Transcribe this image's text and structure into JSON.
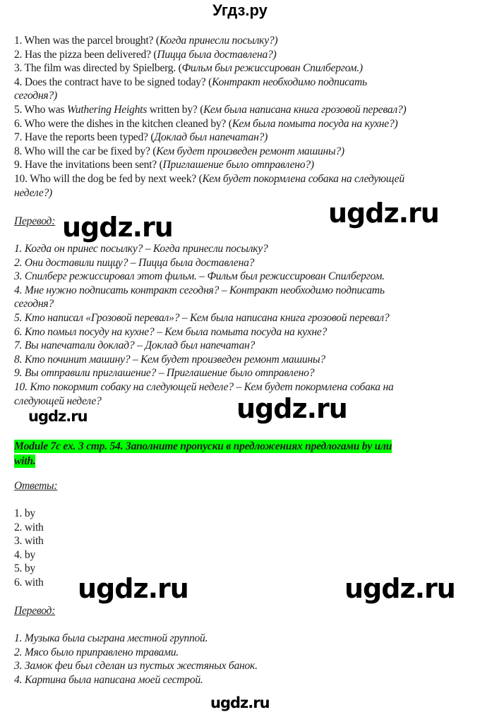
{
  "site_title": "Угдз.ру",
  "questions": [
    {
      "en": "1. When was the parcel brought? (",
      "ru": "Когда принесли посылку?)"
    },
    {
      "en": "2. Has the pizza been delivered? (",
      "ru": "Пицца была доставлена?)"
    },
    {
      "en": "3. The film was directed by Spielberg. (",
      "ru": "Фильм был режиссирован Спилбергом.)"
    },
    {
      "en": "4. Does the contract have to be signed today? (",
      "ru": "Контракт необходимо подписать",
      "ru2": "сегодня?)"
    },
    {
      "en_pre": "5. Who was ",
      "en_italic": "Wuthering Heights",
      "en": " written by? (",
      "ru": "Кем была написана книга грозовой перевал?)"
    },
    {
      "en": "6. Who were the dishes in the kitchen cleaned by? (",
      "ru": "Кем была помыта посуда на кухне?)"
    },
    {
      "en": "7. Have the reports been typed? (",
      "ru": "Доклад был напечатан?)"
    },
    {
      "en": "8. Who will the car be fixed by? (",
      "ru": "Кем будет произведен ремонт машины?)"
    },
    {
      "en": "9. Have the invitations been sent? (",
      "ru": "Приглашение было отправлено?)"
    },
    {
      "en": "10. Who will the dog be fed by next week? (",
      "ru": "Кем будет покормлена собака на следующей",
      "ru2": "неделе?)"
    }
  ],
  "translation1": {
    "heading": "Перевод:",
    "lines": [
      "1. Когда он принес посылку? – Когда принесли посылку?",
      "2. Они доставили пиццу? – Пицца была доставлена?",
      "3. Спилберг режиссировал этот фильм. – Фильм был режиссирован Спилбергом.",
      "4. Мне нужно подписать контракт сегодня? – Контракт необходимо подписать",
      "сегодня?",
      "5. Кто написал «Грозовой перевал»? – Кем была написана книга грозовой перевал?",
      "6. Кто помыл посуду на кухне? – Кем была помыта посуда на кухне?",
      "7. Вы напечатали доклад? – Доклад был напечатан?",
      "8. Кто починит машину? – Кем будет произведен ремонт машины?",
      "9. Вы отправили приглашение? – Приглашение было отправлено?",
      "10. Кто покормит собаку на следующей неделе? – Кем будет покормлена собака на",
      "следующей неделе?"
    ]
  },
  "task": {
    "line1": "Module 7c ex. 3 стр. 54.  Заполните пропуски в предложениях предлогами by или",
    "line2": "with.",
    "highlight_color": "#00ff00"
  },
  "answers": {
    "heading": "Ответы:",
    "items": [
      "1. by",
      "2. with",
      "3. with",
      "4. by",
      "5. by",
      "6. with"
    ]
  },
  "translation2": {
    "heading": "Перевод:",
    "lines": [
      "1. Музыка была сыграна местной группой.",
      "2. Мясо было приправлено травами.",
      "3. Замок феи был сделан из пустых жестяных банок.",
      "4. Картина была написана моей сестрой."
    ]
  },
  "watermarks": [
    "ugdz.ru",
    "ugdz.ru",
    "ugdz.ru",
    "ugdz.ru",
    "ugdz.ru",
    "ugdz.ru",
    "ugdz.ru"
  ]
}
